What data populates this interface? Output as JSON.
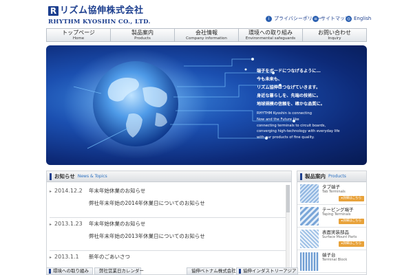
{
  "header": {
    "logo_mark": "R",
    "logo_jp": "リズム協伸株式会社",
    "logo_en": "RHYTHM KYOSHIN CO., LTD.",
    "links": [
      {
        "label": "プライバシーポリシー",
        "icon": "privacy-icon"
      },
      {
        "label": "サイトマップ",
        "icon": "sitemap-icon"
      },
      {
        "label": "English",
        "icon": "globe-icon"
      }
    ]
  },
  "nav": [
    {
      "jp": "トップページ",
      "en": "Home"
    },
    {
      "jp": "製品案内",
      "en": "Products"
    },
    {
      "jp": "会社情報",
      "en": "Company information"
    },
    {
      "jp": "環境への取り組み",
      "en": "Environmental safeguards"
    },
    {
      "jp": "お問い合わせ",
      "en": "Inquiry"
    }
  ],
  "hero": {
    "jp_lines": [
      "端子をボードにつなげるように…",
      "今も未来も、",
      "リズム協伸はつなげていきます。",
      "身近な暮らしを、先端の技術に。",
      "地球規模の信頼を、確かな品質に。"
    ],
    "en_lines": [
      "RHYTHM Kyoshin is connecting",
      "Now and the Future like",
      "connecting terminals to circuit boards,",
      "converging high-technology with everyday life",
      "with our products of fine quality."
    ]
  },
  "news": {
    "title_jp": "お知らせ",
    "title_en": "News & Topics",
    "items": [
      {
        "date": "2014.12.2",
        "title": "年末年始休業のお知らせ",
        "body": "弊社年末年始の2014年休業日についてのお知らせ"
      },
      {
        "date": "2013.1.23",
        "title": "年末年始休業のお知らせ",
        "body": "弊社年末年始の2013年休業日についてのお知らせ"
      },
      {
        "date": "2013.1.1",
        "title": "新年のごあいさつ",
        "body": ""
      }
    ]
  },
  "products": {
    "title_jp": "製品案内",
    "title_en": "Products",
    "button_label": "▸詳細はこちら",
    "items": [
      {
        "jp": "タブ端子",
        "en": "Tab Terminals"
      },
      {
        "jp": "テーピング端子",
        "en": "Taping Terminals"
      },
      {
        "jp": "表面実装部品",
        "en": "Surface Mount Parts"
      },
      {
        "jp": "端子台",
        "en": "Terminal Block"
      }
    ]
  },
  "banners": [
    "環境への取り組み",
    "弊社営業日カレンダー",
    "協伸ベトナム株式会社",
    "協伸インダストリーアジア"
  ]
}
